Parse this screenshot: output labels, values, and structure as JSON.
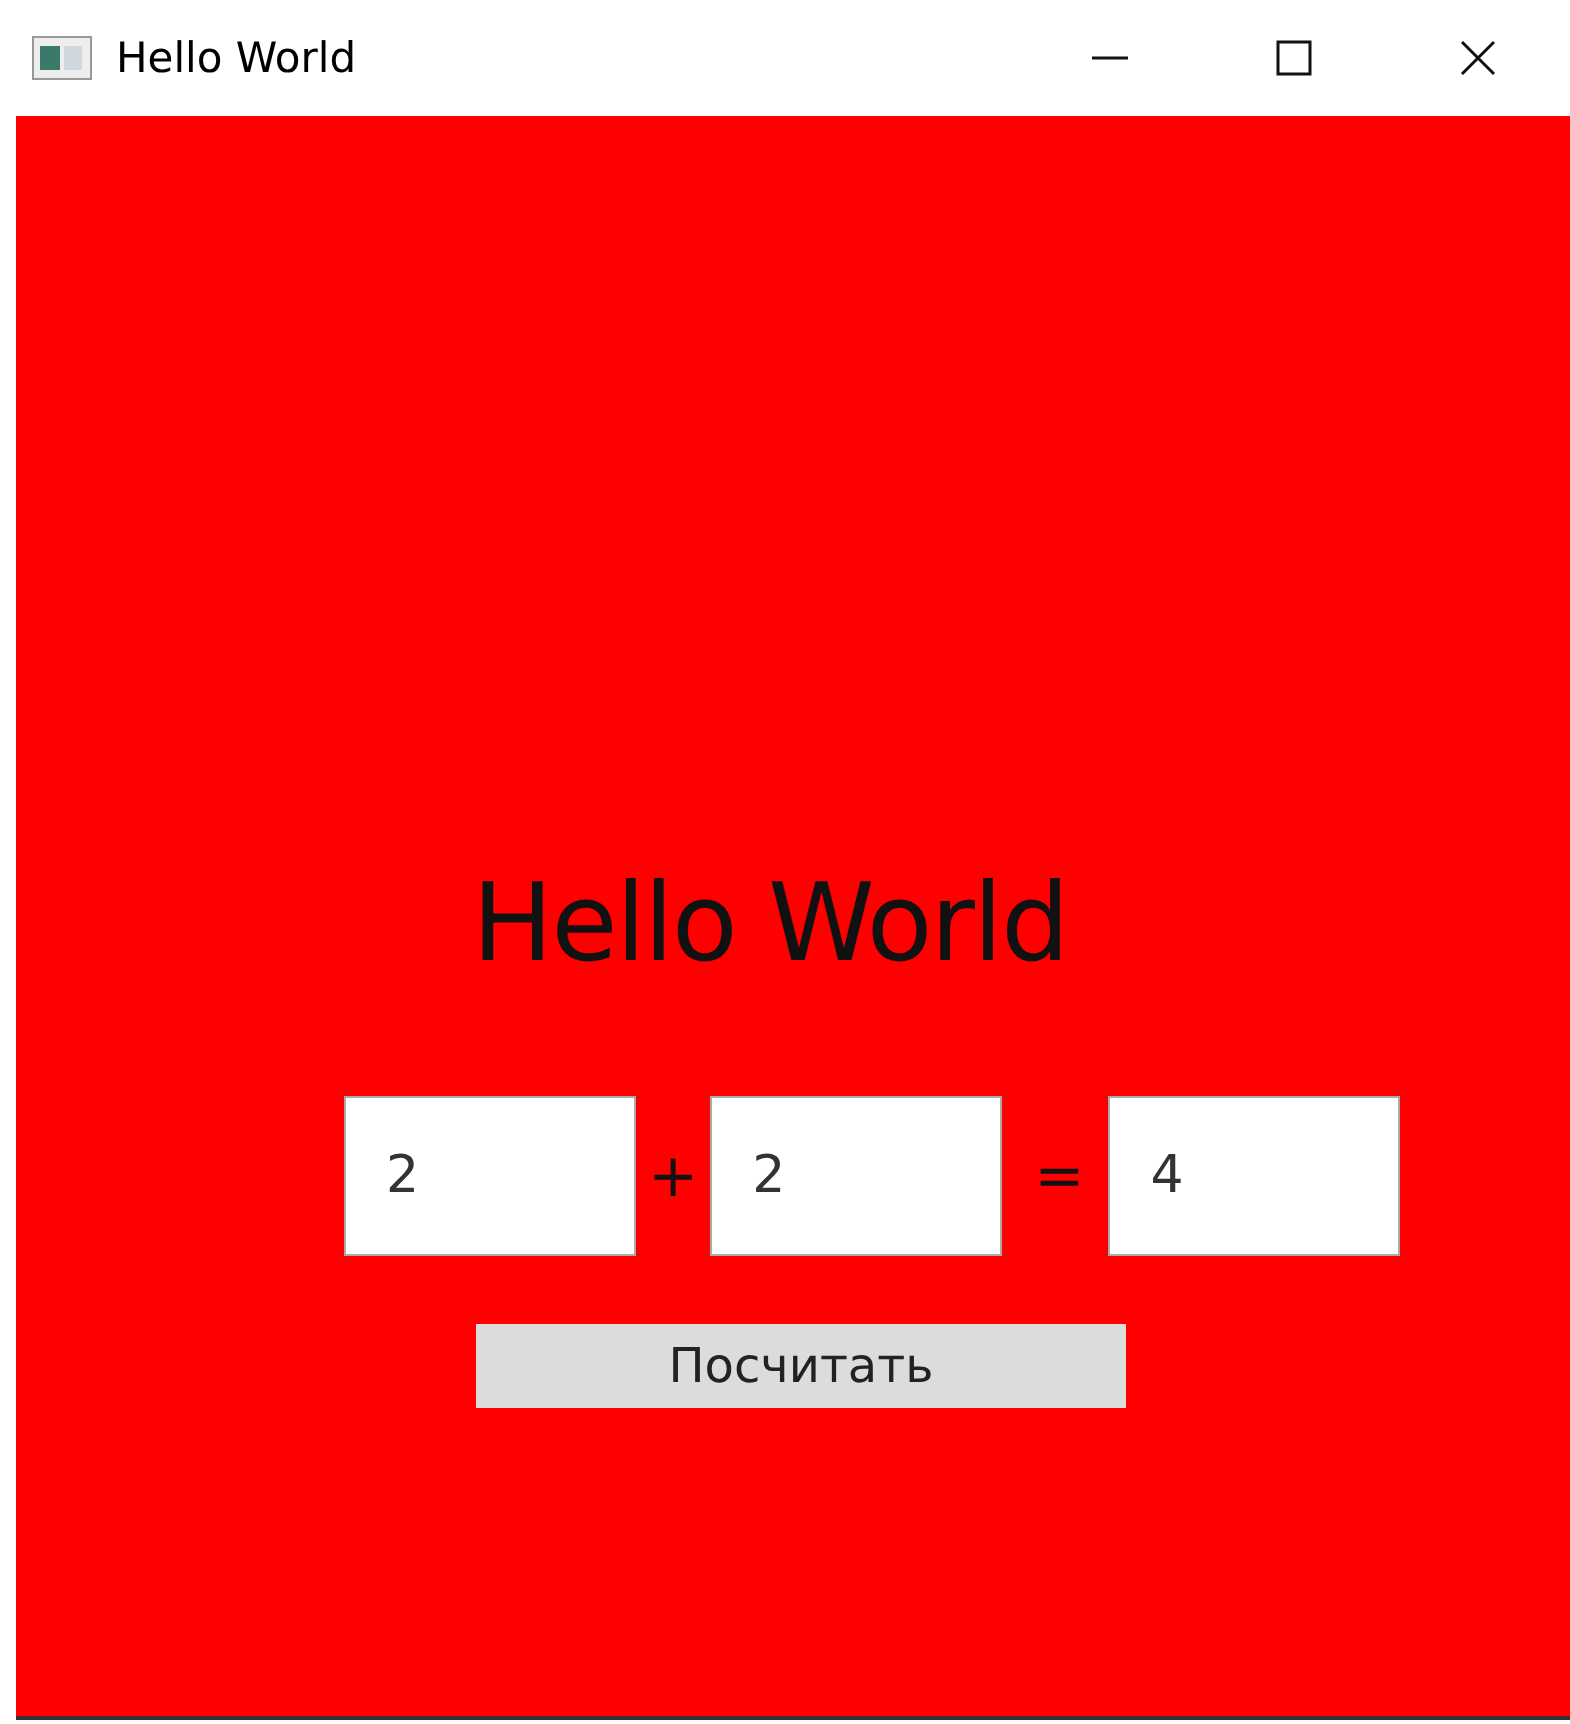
{
  "window": {
    "title": "Hello World"
  },
  "heading": "Hello World",
  "inputs": [
    {
      "value": "2"
    },
    {
      "value": "2"
    },
    {
      "value": "4"
    }
  ],
  "operators": [
    "+",
    "="
  ],
  "button": "Посчитать"
}
